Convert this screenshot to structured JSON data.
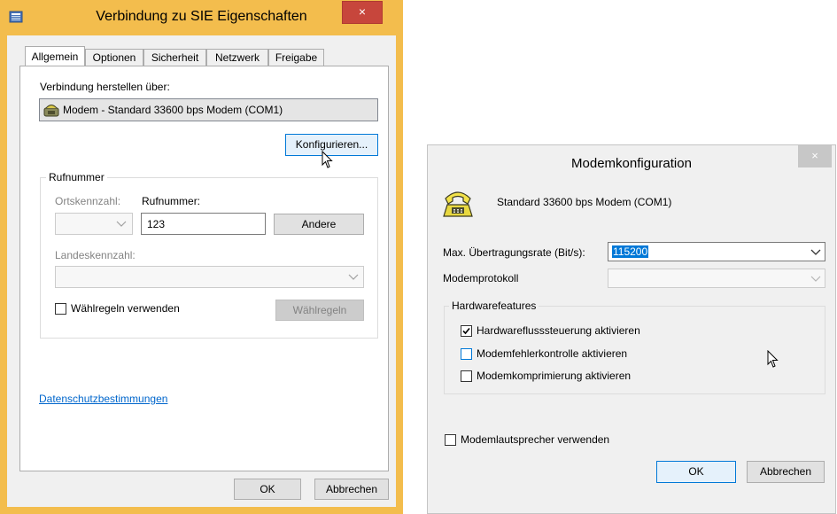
{
  "dialog1": {
    "title": "Verbindung zu SIE Eigenschaften",
    "close_glyph": "×",
    "tabs": [
      "Allgemein",
      "Optionen",
      "Sicherheit",
      "Netzwerk",
      "Freigabe"
    ],
    "connect_via_label": "Verbindung herstellen über:",
    "device": "Modem - Standard 33600 bps Modem (COM1)",
    "configure_button": "Konfigurieren...",
    "phone_group_label": "Rufnummer",
    "area_code_label": "Ortskennzahl:",
    "phone_number_label": "Rufnummer:",
    "phone_number_value": "123",
    "other_button": "Andere",
    "country_code_label": "Landeskennzahl:",
    "use_dialing_rules_label": "Wählregeln verwenden",
    "dialing_rules_button": "Wählregeln",
    "privacy_link": "Datenschutzbestimmungen",
    "ok_button": "OK",
    "cancel_button": "Abbrechen"
  },
  "dialog2": {
    "title": "Modemkonfiguration",
    "close_glyph": "×",
    "modem_name": "Standard 33600 bps Modem (COM1)",
    "max_rate_label": "Max. Übertragungsrate (Bit/s):",
    "max_rate_value": "115200",
    "protocol_label": "Modemprotokoll",
    "hardware_group_label": "Hardwarefeatures",
    "hw_flow_label": "Hardwareflusssteuerung aktivieren",
    "hw_flow_checked": true,
    "error_control_label": "Modemfehlerkontrolle aktivieren",
    "error_control_checked": false,
    "compression_label": "Modemkomprimierung aktivieren",
    "compression_checked": false,
    "speaker_label": "Modemlautsprecher verwenden",
    "speaker_checked": false,
    "ok_button": "OK",
    "cancel_button": "Abbrechen"
  },
  "colors": {
    "window1_frame": "#f3bd4d",
    "close_red": "#c7463c",
    "link_blue": "#0066cc",
    "focus_blue": "#0078d7"
  }
}
